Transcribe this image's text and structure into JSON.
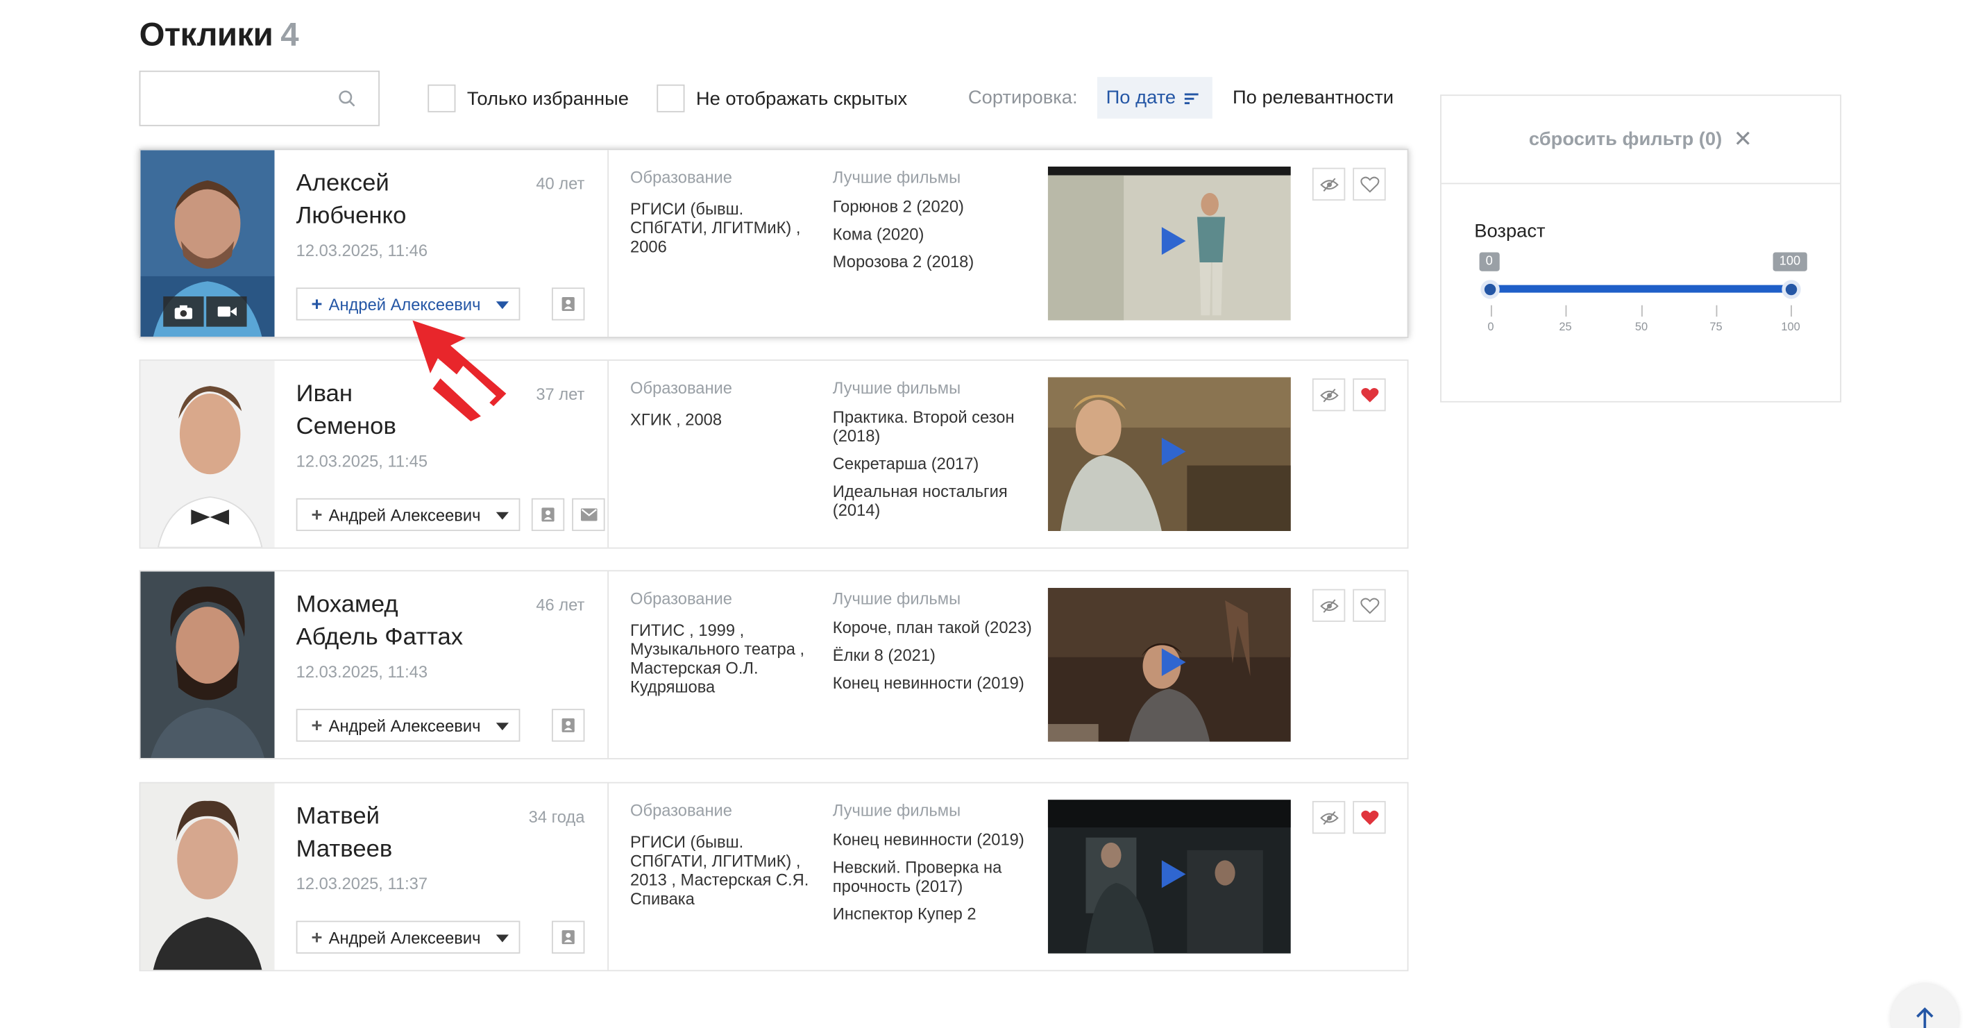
{
  "header": {
    "title": "Отклики",
    "count": "4"
  },
  "search": {
    "placeholder": ""
  },
  "filters": {
    "only_favorites": "Только избранные",
    "hide_hidden": "Не отображать скрытых",
    "sort_label": "Сортировка:",
    "sort_by_date": "По дате",
    "sort_by_relevance": "По релевантности"
  },
  "columns": {
    "education": "Образование",
    "best_films": "Лучшие фильмы"
  },
  "responses": [
    {
      "first_name": "Алексей",
      "last_name": "Любченко",
      "age": "40 лет",
      "date": "12.03.2025, 11:46",
      "assignee": "Андрей Алексеевич",
      "education": "РГИСИ (бывш. СПбГАТИ, ЛГИТМиК) , 2006",
      "films": [
        "Горюнов 2 (2020)",
        "Кома (2020)",
        "Морозова 2 (2018)"
      ],
      "favorite": false
    },
    {
      "first_name": "Иван",
      "last_name": "Семенов",
      "age": "37 лет",
      "date": "12.03.2025, 11:45",
      "assignee": "Андрей Алексеевич",
      "education": "ХГИК , 2008",
      "films": [
        "Практика. Второй сезон (2018)",
        "Секретарша (2017)",
        "Идеальная ностальгия (2014)"
      ],
      "favorite": true
    },
    {
      "first_name": "Мохамед",
      "last_name": "Абдель Фаттах",
      "age": "46 лет",
      "date": "12.03.2025, 11:43",
      "assignee": "Андрей Алексеевич",
      "education": "ГИТИС , 1999 , Музыкального театра , Мастерская О.Л. Кудряшова",
      "films": [
        "Короче, план такой (2023)",
        "Ёлки 8 (2021)",
        "Конец невинности (2019)"
      ],
      "favorite": false
    },
    {
      "first_name": "Матвей",
      "last_name": "Матвеев",
      "age": "34 года",
      "date": "12.03.2025, 11:37",
      "assignee": "Андрей Алексеевич",
      "education": "РГИСИ (бывш. СПбГАТИ, ЛГИТМиК) , 2013 , Мастерская С.Я. Спивака",
      "films": [
        "Конец невинности (2019)",
        "Невский. Проверка на прочность (2017)",
        "Инспектор Купер 2"
      ],
      "favorite": true
    }
  ],
  "sidebar": {
    "reset_filter": "сбросить фильтр (0)",
    "age_label": "Возраст",
    "age_min": "0",
    "age_max": "100",
    "ticks": [
      "0",
      "25",
      "50",
      "75",
      "100"
    ]
  },
  "colors": {
    "accent": "#2456a5",
    "heart": "#e0343c",
    "annotation": "#e8262b"
  }
}
